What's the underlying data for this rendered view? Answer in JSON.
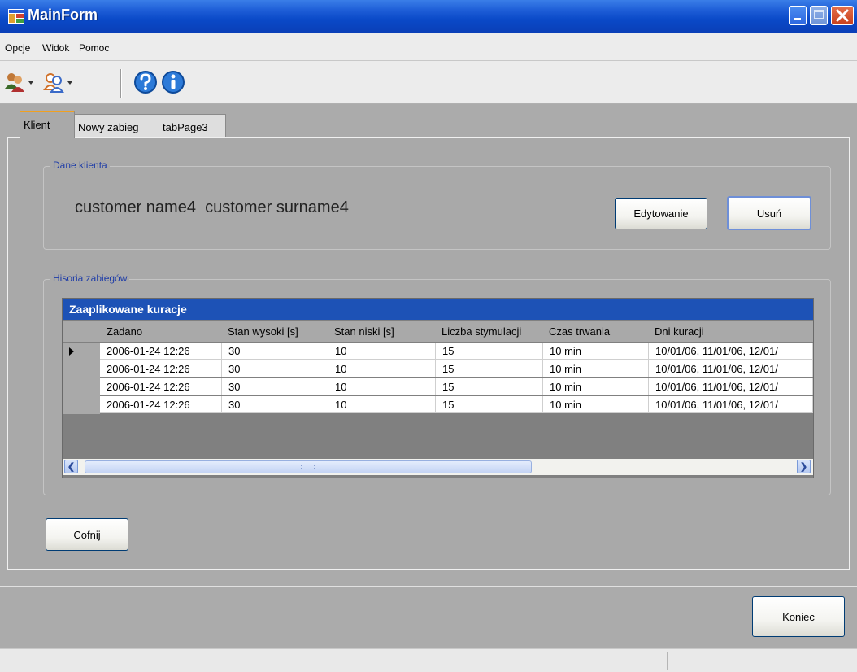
{
  "window": {
    "title": "MainForm"
  },
  "menu": {
    "items": [
      "Opcje",
      "Widok",
      "Pomoc"
    ]
  },
  "toolbar": {
    "icons": [
      "clients-icon",
      "customer-group-icon",
      "help-icon",
      "info-icon"
    ]
  },
  "tabs": [
    {
      "label": "Klient",
      "active": true
    },
    {
      "label": "Nowy zabieg",
      "active": false
    },
    {
      "label": "tabPage3",
      "active": false
    }
  ],
  "client_group": {
    "title": "Dane klienta",
    "customer_name": "customer name4",
    "customer_surname": "customer surname4",
    "edit_label": "Edytowanie",
    "delete_label": "Usuń"
  },
  "history_group": {
    "title": "Hisoria zabiegów",
    "grid": {
      "caption": "Zaaplikowane kuracje",
      "columns": [
        "Zadano",
        "Stan wysoki [s]",
        "Stan niski [s]",
        "Liczba stymulacji",
        "Czas trwania",
        "Dni kuracji"
      ],
      "rows": [
        [
          "2006-01-24 12:26",
          "30",
          "10",
          "15",
          "10 min",
          "10/01/06, 11/01/06, 12/01/"
        ],
        [
          "2006-01-24 12:26",
          "30",
          "10",
          "15",
          "10 min",
          "10/01/06, 11/01/06, 12/01/"
        ],
        [
          "2006-01-24 12:26",
          "30",
          "10",
          "15",
          "10 min",
          "10/01/06, 11/01/06, 12/01/"
        ],
        [
          "2006-01-24 12:26",
          "30",
          "10",
          "15",
          "10 min",
          "10/01/06, 11/01/06, 12/01/"
        ]
      ],
      "selected_row": 0
    }
  },
  "back_label": "Cofnij",
  "end_label": "Koniec"
}
